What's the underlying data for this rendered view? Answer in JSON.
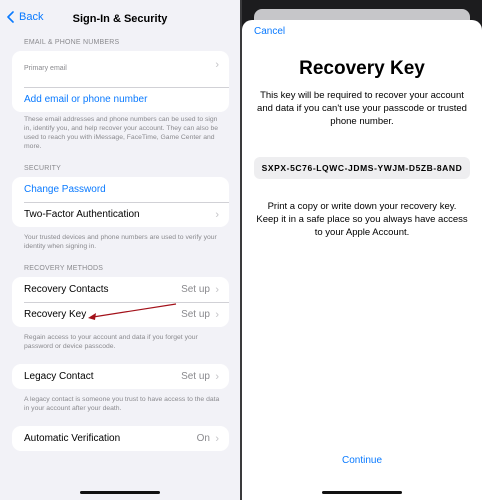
{
  "left": {
    "nav": {
      "back_label": "Back",
      "title": "Sign-In & Security"
    },
    "email_section": {
      "header": "EMAIL & PHONE NUMBERS",
      "primary_label": "Primary email",
      "add_label": "Add email or phone number",
      "footnote": "These email addresses and phone numbers can be used to sign in, identify you, and help recover your account. They can also be used to reach you with iMessage, FaceTime, Game Center and more."
    },
    "security_section": {
      "header": "SECURITY",
      "change_password": "Change Password",
      "two_factor": "Two-Factor Authentication",
      "footnote": "Your trusted devices and phone numbers are used to verify your identity when signing in."
    },
    "recovery_section": {
      "header": "RECOVERY METHODS",
      "rows": [
        {
          "label": "Recovery Contacts",
          "value": "Set up"
        },
        {
          "label": "Recovery Key",
          "value": "Set up"
        }
      ],
      "footnote": "Regain access to your account and data if you forget your password or device passcode."
    },
    "legacy": {
      "label": "Legacy Contact",
      "value": "Set up",
      "footnote": "A legacy contact is someone you trust to have access to the data in your account after your death."
    },
    "auto_verify": {
      "label": "Automatic Verification",
      "value": "On"
    }
  },
  "right": {
    "cancel_label": "Cancel",
    "title": "Recovery Key",
    "description": "This key will be required to recover your account and data if you can't use your passcode or trusted phone number.",
    "key": "SXPX-5C76-LQWC-JDMS-YWJM-D5ZB-8AND",
    "instructions": "Print a copy or write down your recovery key. Keep it in a safe place so you always have access to your Apple Account.",
    "continue_label": "Continue"
  },
  "colors": {
    "accent": "#0a7aff",
    "annotation_arrow": "#a3111a",
    "grouped_bg": "#f2f2f7"
  },
  "icons": {
    "back": "chevron-left-icon",
    "disclosure": "chevron-right-icon"
  }
}
